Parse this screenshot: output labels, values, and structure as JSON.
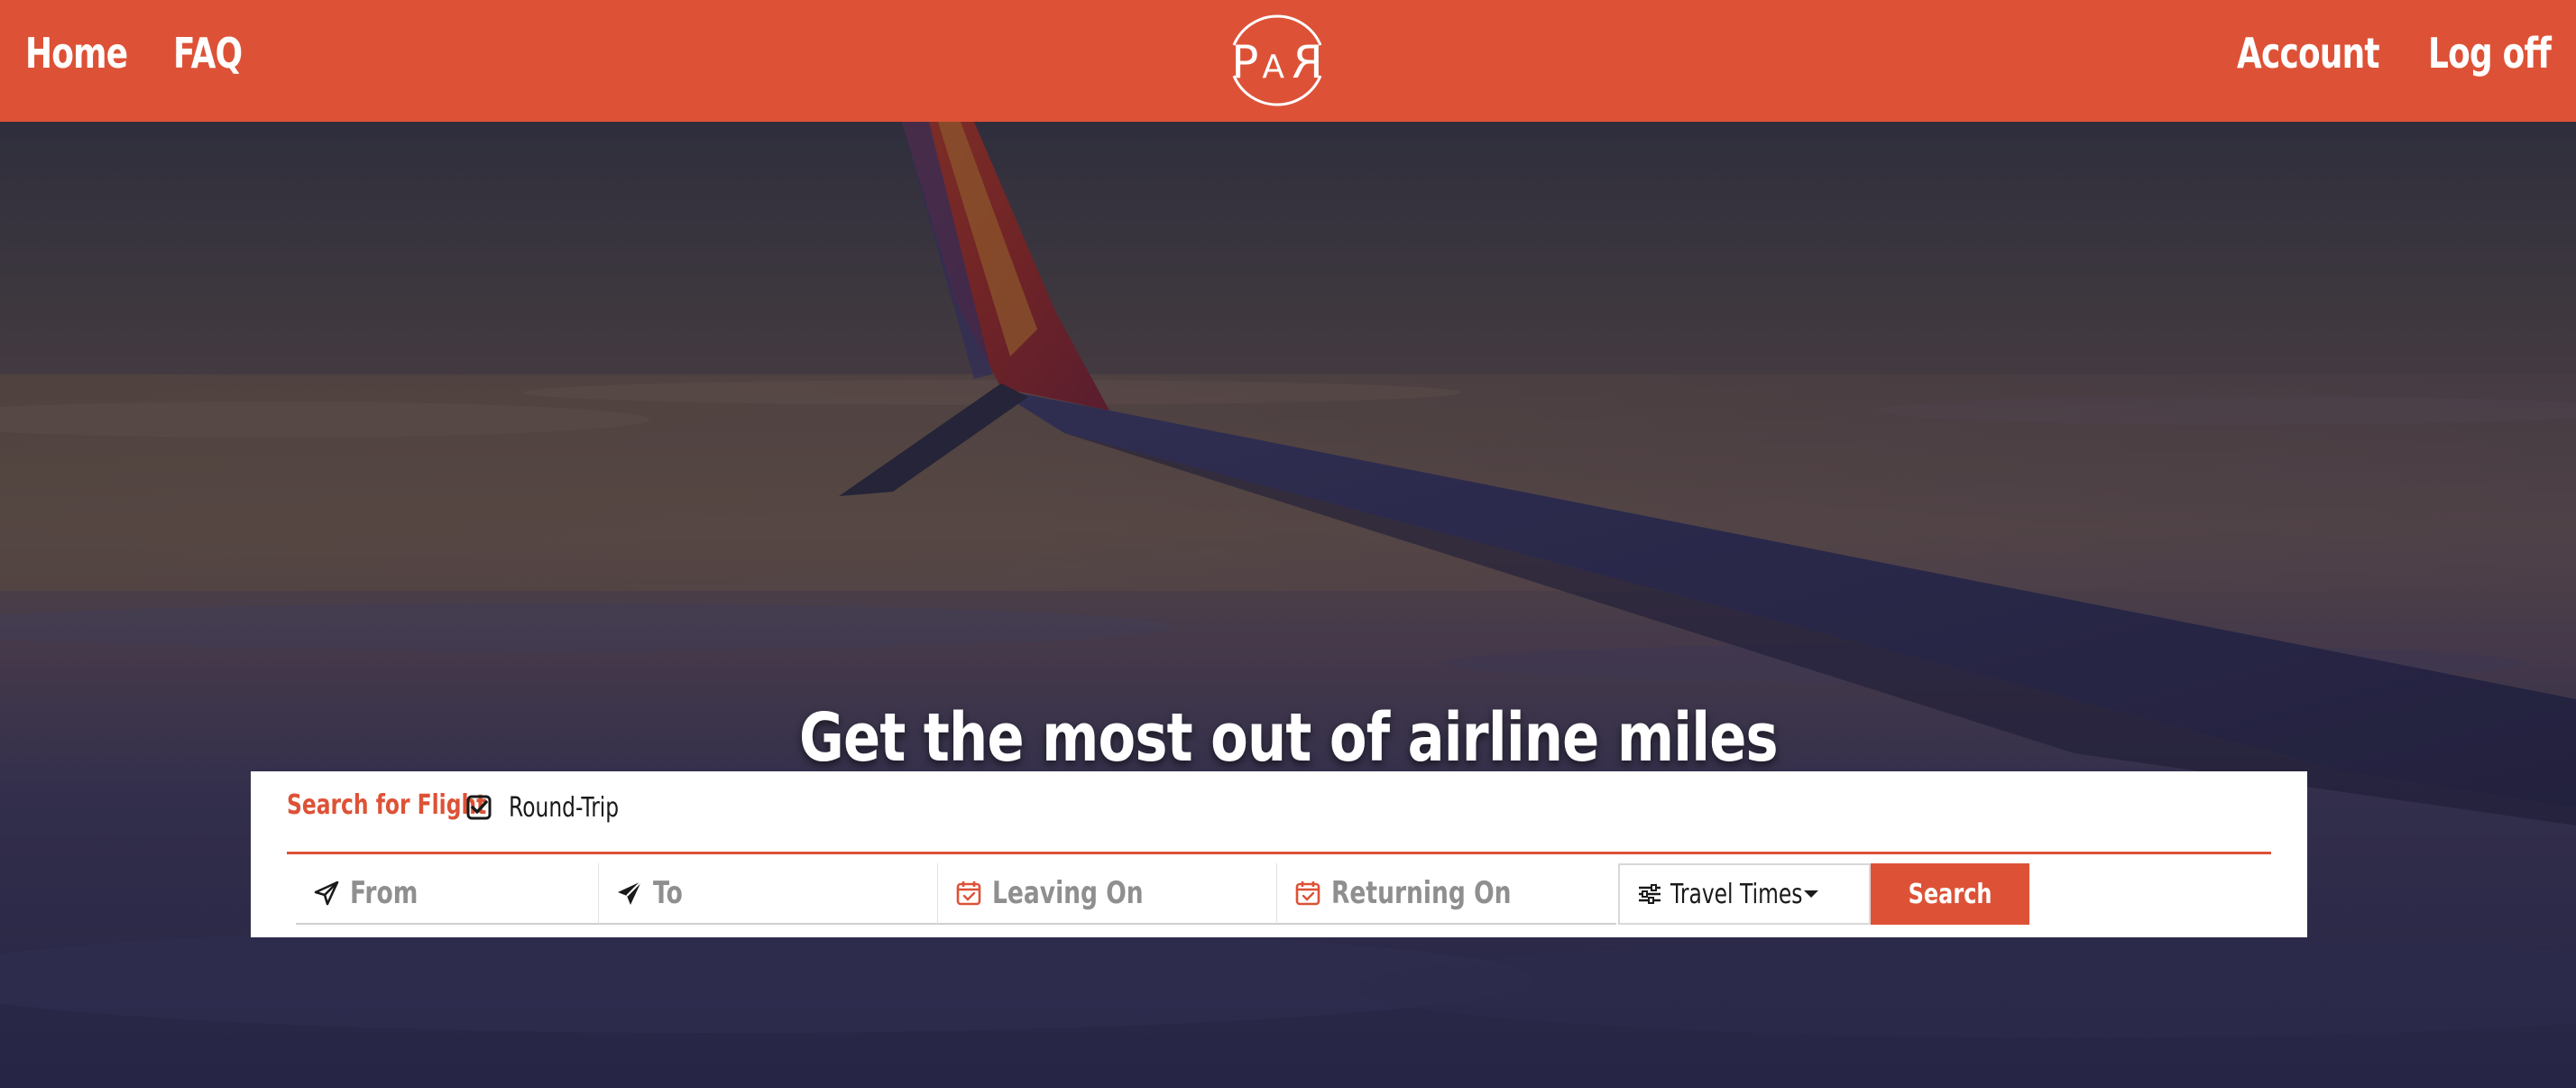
{
  "nav": {
    "home_label": "Home",
    "faq_label": "FAQ",
    "account_label": "Account",
    "logoff_label": "Log off",
    "logo_text": "PAR"
  },
  "hero": {
    "headline": "Get the most out of airline miles"
  },
  "search": {
    "title": "Search for Flight",
    "roundtrip_label": "Round-Trip",
    "roundtrip_checked": true,
    "from_placeholder": "From",
    "to_placeholder": "To",
    "leaving_placeholder": "Leaving On",
    "returning_placeholder": "Returning On",
    "travel_times_label": "Travel Times",
    "search_button_label": "Search"
  },
  "icons": {
    "from": "paper-plane-outline-icon",
    "to": "paper-plane-solid-icon",
    "leaving": "calendar-check-icon",
    "returning": "calendar-check-icon",
    "travel_times": "sliders-icon",
    "dropdown": "caret-down-icon",
    "roundtrip": "check-square-icon"
  },
  "colors": {
    "brand": "#DD5237",
    "panel_bg": "#FFFFFF",
    "placeholder": "#8F8F8F",
    "text_dark": "#1A1A1A"
  }
}
